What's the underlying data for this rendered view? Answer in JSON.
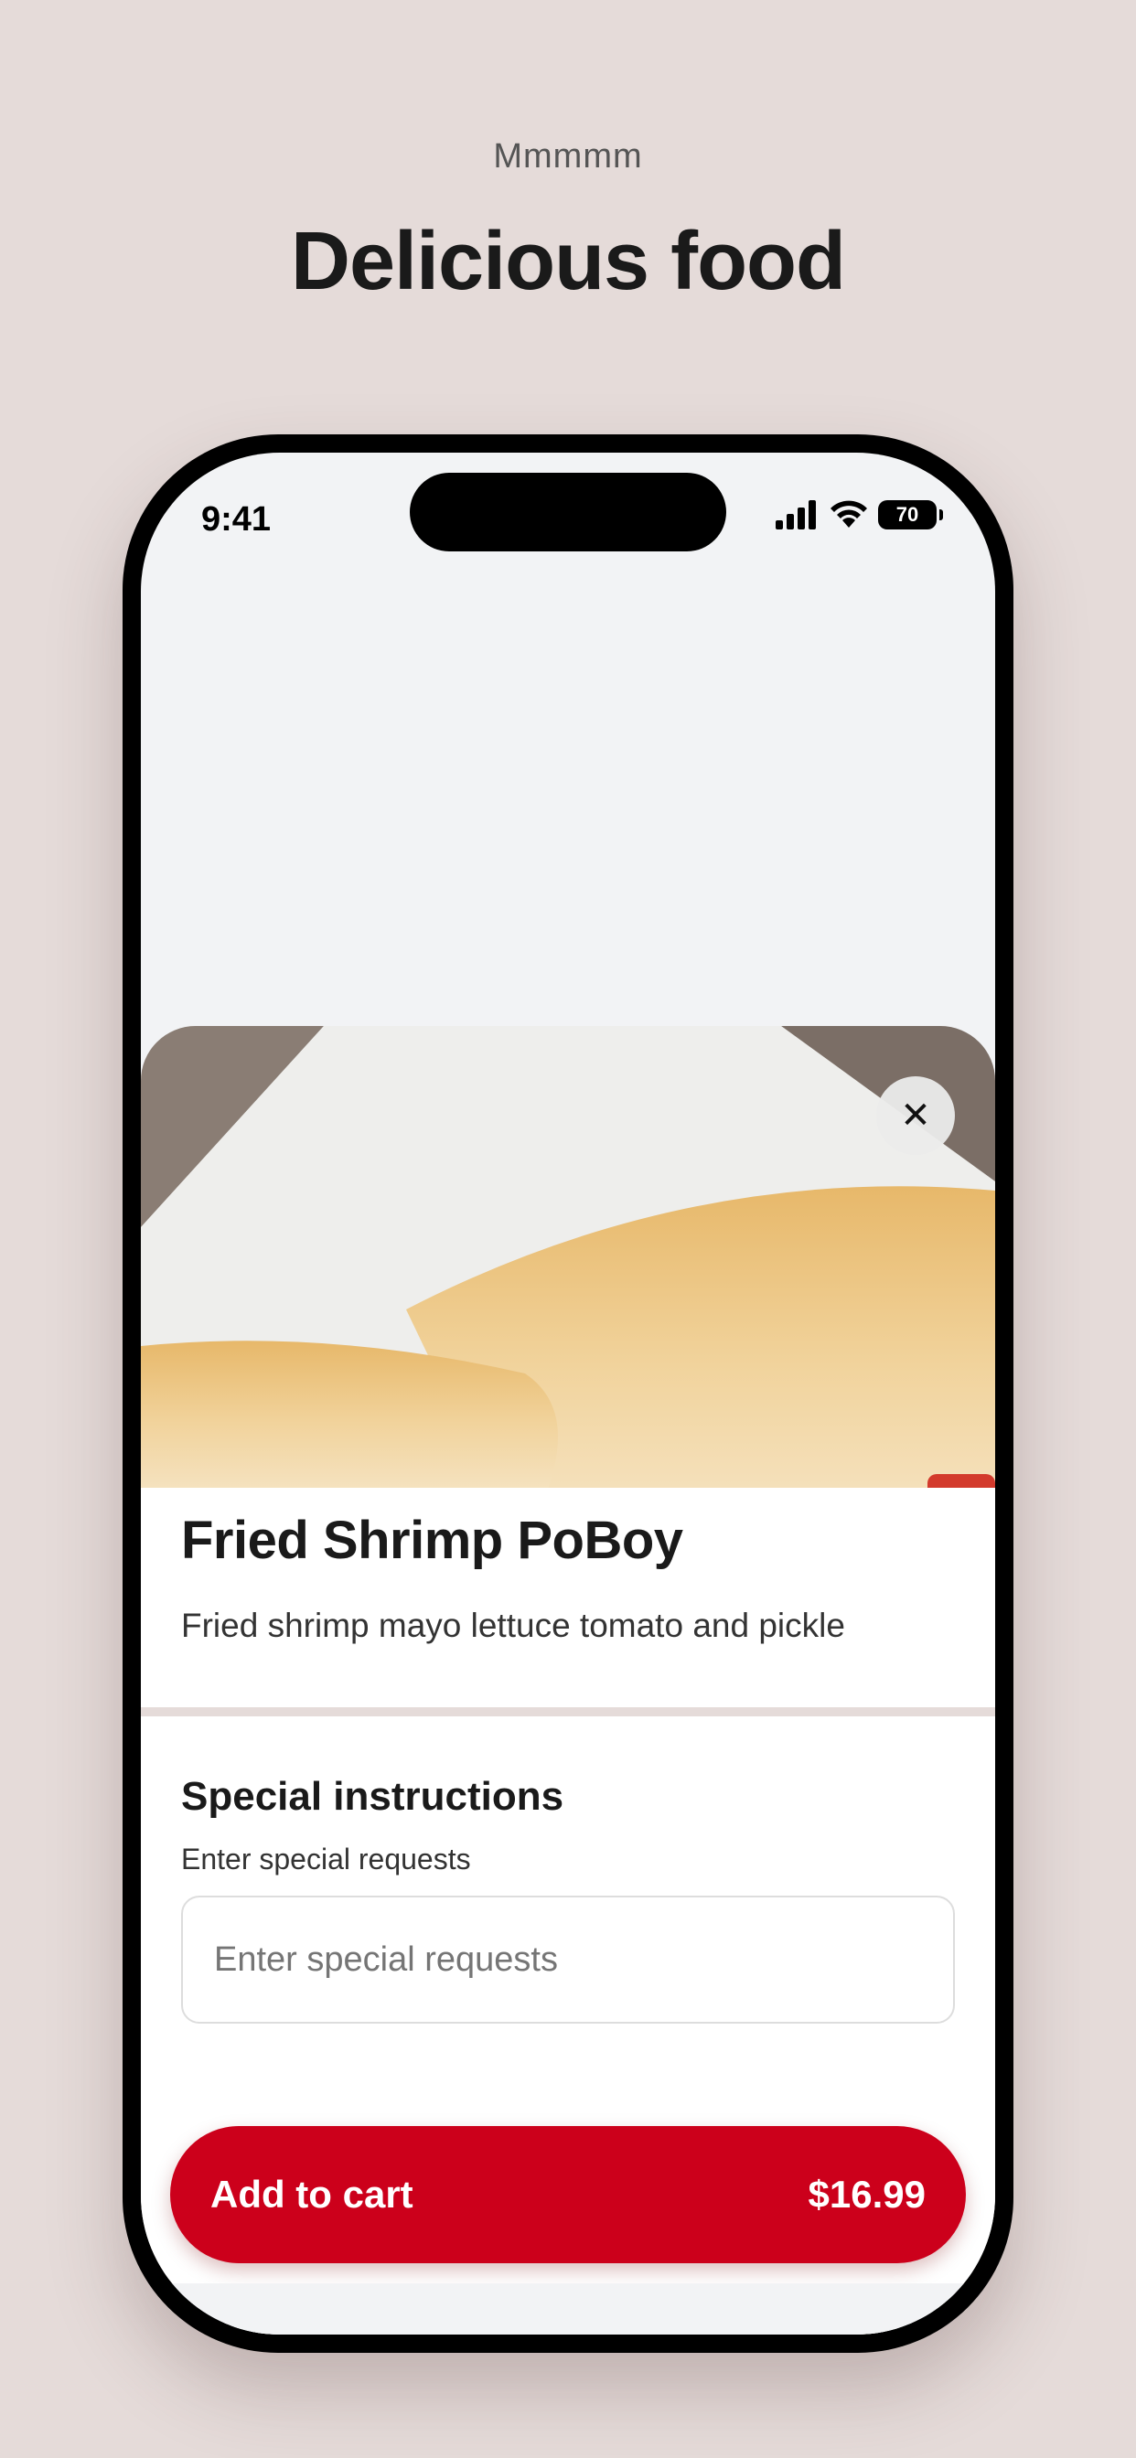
{
  "header": {
    "eyebrow": "Mmmmm",
    "headline": "Delicious food"
  },
  "status_bar": {
    "time": "9:41",
    "battery": "70",
    "icons": [
      "signal-icon",
      "wifi-icon",
      "battery-icon"
    ]
  },
  "item": {
    "image_icon": "sandwich-photo",
    "close_icon": "close-icon",
    "title": "Fried Shrimp PoBoy",
    "description": "Fried shrimp mayo lettuce tomato and pickle"
  },
  "special_instructions": {
    "title": "Special instructions",
    "subtitle": "Enter special requests",
    "placeholder": "Enter special requests",
    "value": ""
  },
  "cta": {
    "label": "Add to cart",
    "price": "$16.99",
    "color": "#cc001b"
  }
}
